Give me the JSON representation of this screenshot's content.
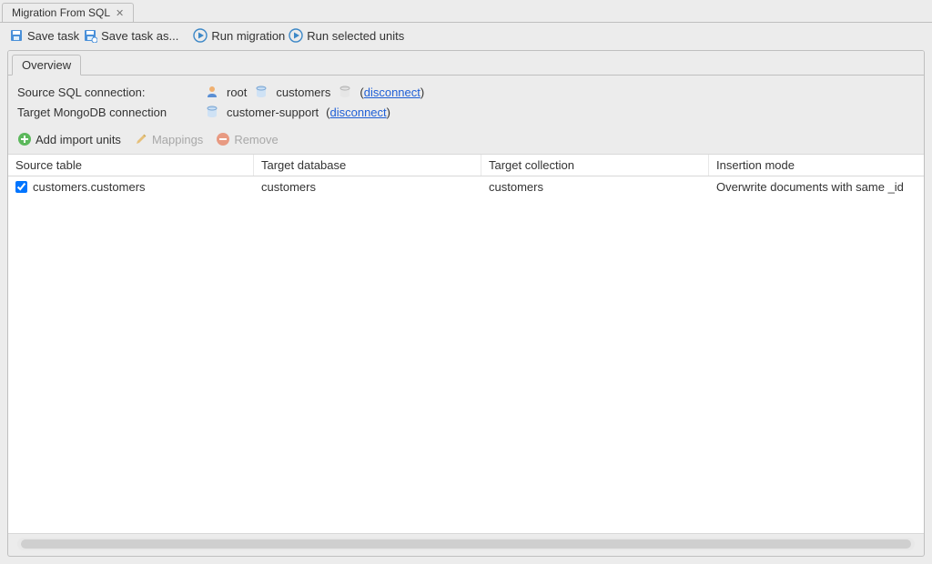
{
  "title_tab": {
    "label": "Migration From SQL"
  },
  "toolbar": {
    "save_task": "Save task",
    "save_task_as": "Save task as...",
    "run_migration": "Run migration",
    "run_selected": "Run selected units"
  },
  "overview_tab": {
    "label": "Overview"
  },
  "connections": {
    "source_label": "Source SQL connection:",
    "source_user": "root",
    "source_db": "customers",
    "target_label": "Target MongoDB connection",
    "target_db": "customer-support",
    "disconnect_label": "disconnect"
  },
  "actions": {
    "add_import_units": "Add import units",
    "mappings": "Mappings",
    "remove": "Remove"
  },
  "table": {
    "headers": {
      "source_table": "Source table",
      "target_database": "Target database",
      "target_collection": "Target collection",
      "insertion_mode": "Insertion mode"
    },
    "rows": [
      {
        "checked": true,
        "source_table": "customers.customers",
        "target_database": "customers",
        "target_collection": "customers",
        "insertion_mode": "Overwrite documents with same _id"
      }
    ]
  }
}
